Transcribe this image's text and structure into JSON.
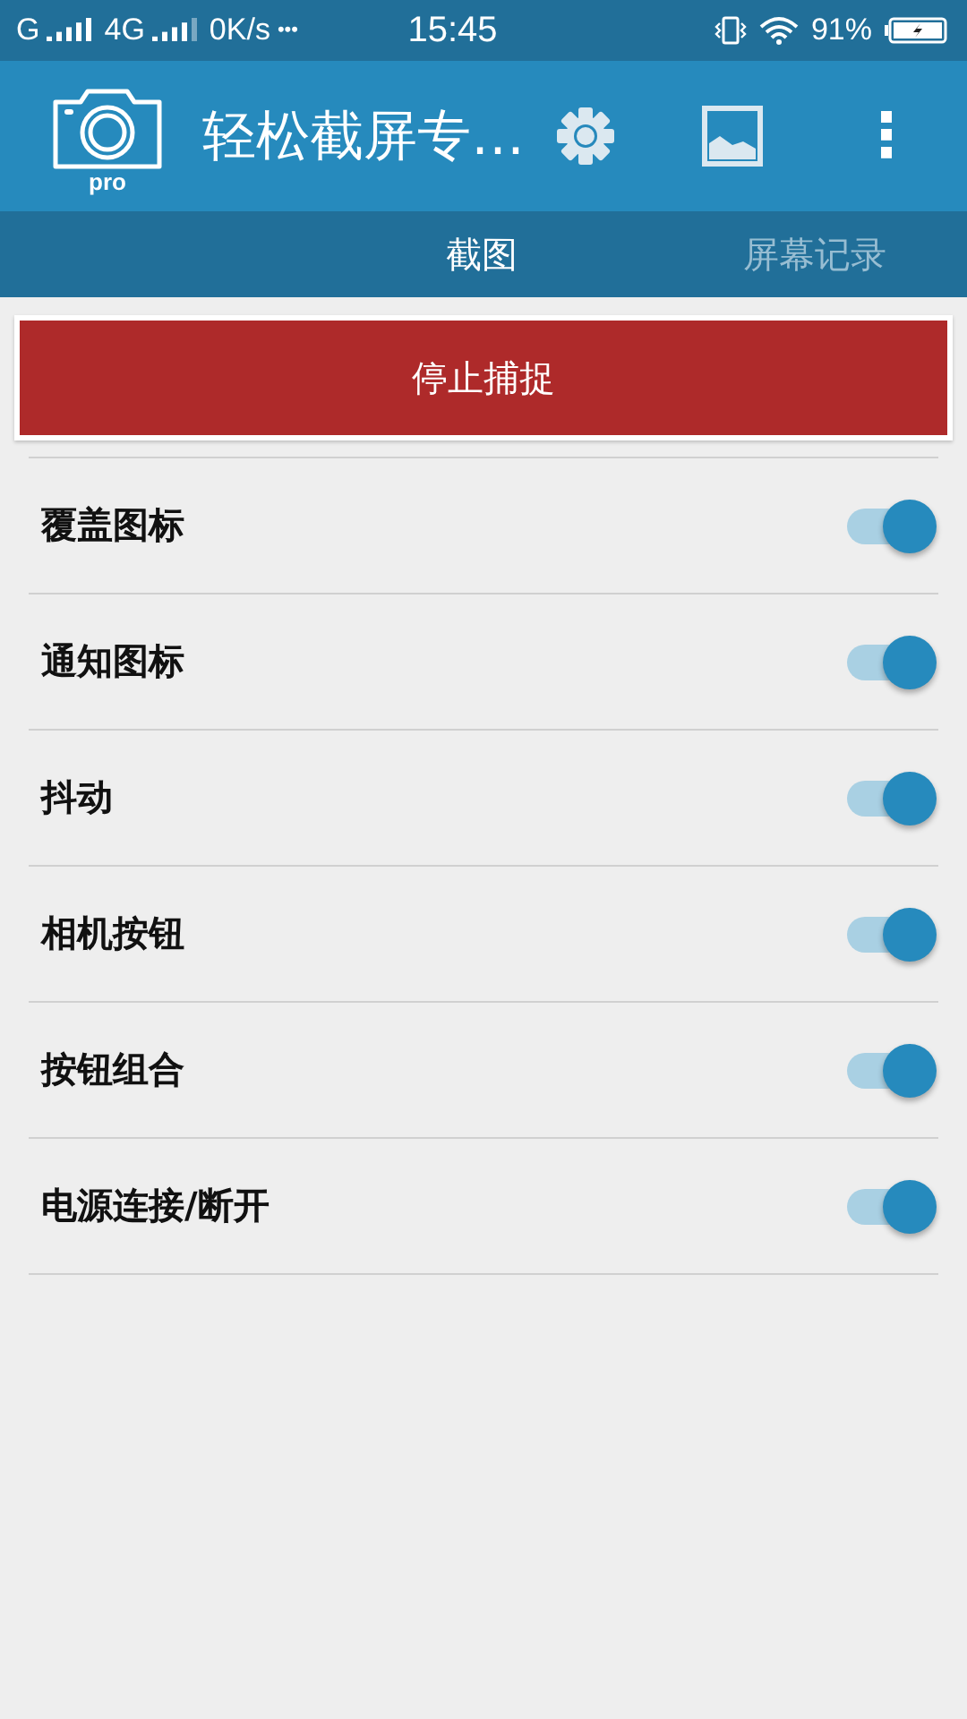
{
  "status_bar": {
    "network_1": "G",
    "network_2": "4G",
    "speed": "0K/s",
    "more": "•••",
    "time": "15:45",
    "battery": "91%"
  },
  "app_bar": {
    "logo_label": "pro",
    "title": "轻松截屏专…",
    "more": "⋮"
  },
  "tabs": [
    {
      "label": "截图",
      "selected": true
    },
    {
      "label": "屏幕记录",
      "selected": false
    }
  ],
  "stop_button": "停止捕捉",
  "settings": [
    {
      "label": "覆盖图标",
      "on": true
    },
    {
      "label": "通知图标",
      "on": true
    },
    {
      "label": "抖动",
      "on": true
    },
    {
      "label": "相机按钮",
      "on": true
    },
    {
      "label": "按钮组合",
      "on": true
    },
    {
      "label": "电源连接/断开",
      "on": true
    }
  ]
}
